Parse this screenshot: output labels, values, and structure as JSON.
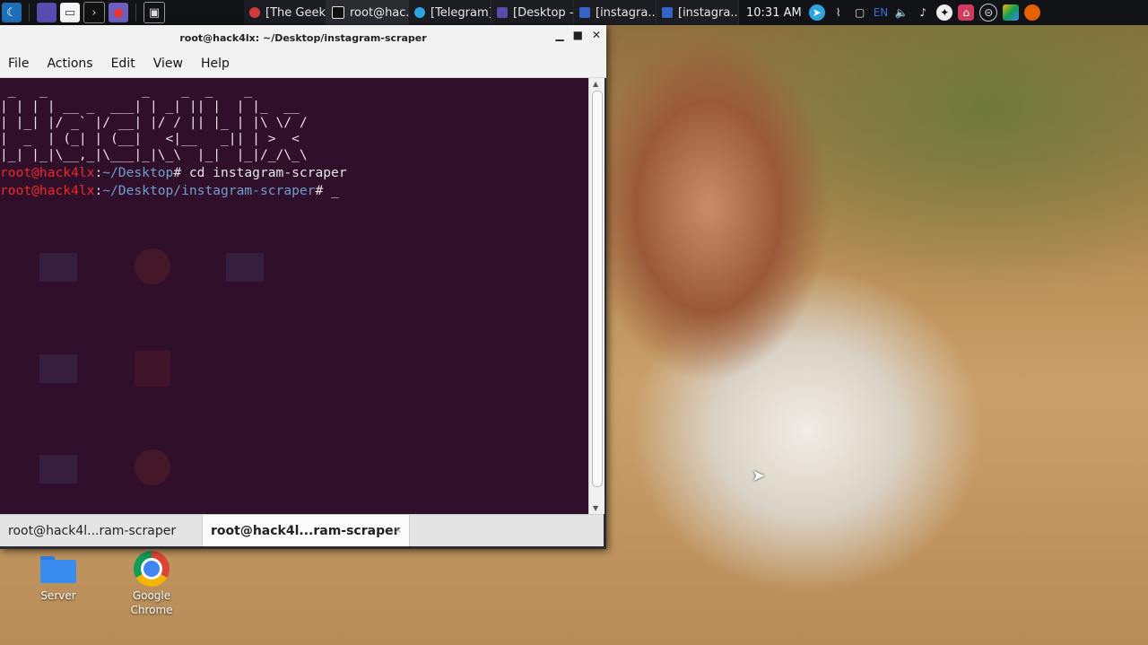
{
  "taskbar": {
    "tasks": [
      {
        "label": "[The Geek...",
        "color": "#d23b3b"
      },
      {
        "label": "root@hac...",
        "color": "#e8e8e8"
      },
      {
        "label": "[Telegram]",
        "color": "#2ca5e0"
      },
      {
        "label": "[Desktop -...",
        "color": "#5b4aa8"
      },
      {
        "label": "[instagra...",
        "color": "#3a63c8"
      },
      {
        "label": "[instagra...",
        "color": "#3a63c8"
      }
    ],
    "clock": "10:31 AM",
    "lang": "EN"
  },
  "window": {
    "title": "root@hack4lx: ~/Desktop/instagram-scraper",
    "menu": [
      "File",
      "Actions",
      "Edit",
      "View",
      "Help"
    ]
  },
  "terminal": {
    "ascii_art": " _   _            _    _  _    _\n| | | | __ _  ___| | _| || |  | |_  __\n| |_| |/ _` |/ __| |/ / || |_ | |\\ \\/ /\n|  _  | (_| | (__|   <|__   _|| | >  <\n|_| |_|\\__,_|\\___|_|\\_\\  |_|  |_|/_/\\_\\",
    "line1": {
      "user": "root@hack4lx",
      "path": "~/Desktop",
      "cmd": "# cd instagram-scraper"
    },
    "line2": {
      "user": "root@hack4lx",
      "path": "~/Desktop/instagram-scraper",
      "cmd": "# _"
    }
  },
  "tabs": [
    {
      "label": "root@hack4l...ram-scraper"
    },
    {
      "label": "root@hack4l...ram-scraper",
      "close": "×"
    }
  ],
  "desktop_icons": [
    {
      "label": "Server"
    },
    {
      "label": "Google Chrome"
    }
  ]
}
